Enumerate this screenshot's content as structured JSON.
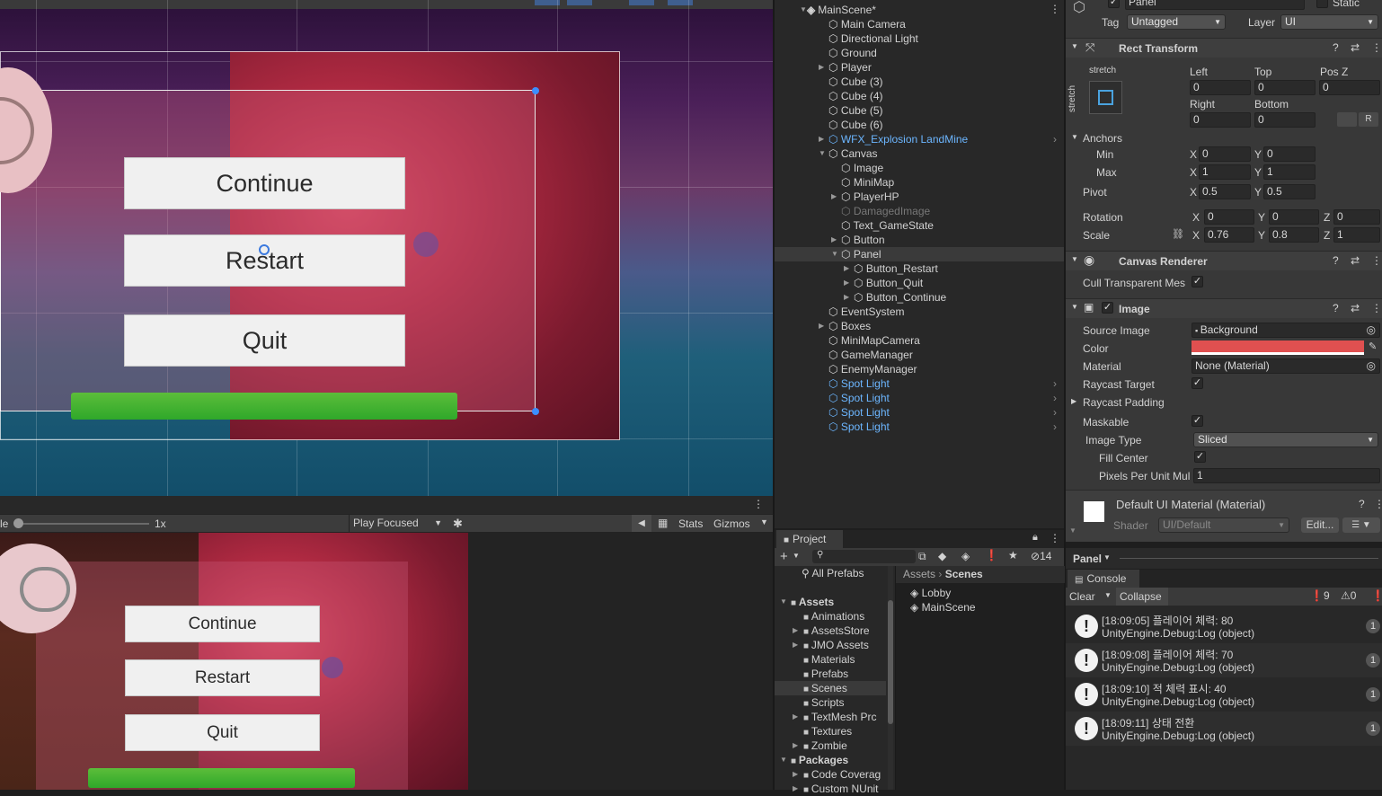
{
  "scene_ui": {
    "continue": "Continue",
    "restart": "Restart",
    "quit": "Quit"
  },
  "game_ui": {
    "continue": "Continue",
    "restart": "Restart",
    "quit": "Quit"
  },
  "game_toolbar": {
    "scale_left": "le",
    "scale_value": "1x",
    "play_mode": "Play Focused",
    "stats": "Stats",
    "gizmos": "Gizmos"
  },
  "hierarchy": {
    "scene": "MainScene*",
    "items": [
      {
        "label": "Main Camera"
      },
      {
        "label": "Directional Light"
      },
      {
        "label": "Ground"
      },
      {
        "label": "Player"
      },
      {
        "label": "Cube (3)"
      },
      {
        "label": "Cube (4)"
      },
      {
        "label": "Cube (5)"
      },
      {
        "label": "Cube (6)"
      },
      {
        "label": "WFX_Explosion LandMine"
      },
      {
        "label": "Canvas"
      },
      {
        "label": "Image"
      },
      {
        "label": "MiniMap"
      },
      {
        "label": "PlayerHP"
      },
      {
        "label": "DamagedImage"
      },
      {
        "label": "Text_GameState"
      },
      {
        "label": "Button"
      },
      {
        "label": "Panel"
      },
      {
        "label": "Button_Restart"
      },
      {
        "label": "Button_Quit"
      },
      {
        "label": "Button_Continue"
      },
      {
        "label": "EventSystem"
      },
      {
        "label": "Boxes"
      },
      {
        "label": "MiniMapCamera"
      },
      {
        "label": "GameManager"
      },
      {
        "label": "EnemyManager"
      },
      {
        "label": "Spot Light"
      },
      {
        "label": "Spot Light"
      },
      {
        "label": "Spot Light"
      },
      {
        "label": "Spot Light"
      }
    ]
  },
  "inspector": {
    "name": "Panel",
    "static": "Static",
    "tag_label": "Tag",
    "tag": "Untagged",
    "layer_label": "Layer",
    "layer": "UI",
    "rect_transform": "Rect Transform",
    "stretch_top": "stretch",
    "stretch_side": "stretch",
    "left": "Left",
    "top": "Top",
    "posz": "Pos Z",
    "left_v": "0",
    "top_v": "0",
    "posz_v": "0",
    "right": "Right",
    "bottom": "Bottom",
    "right_v": "0",
    "bottom_v": "0",
    "r_btn": "R",
    "anchors": "Anchors",
    "min": "Min",
    "max": "Max",
    "x": "X",
    "y": "Y",
    "z": "Z",
    "min_x": "0",
    "min_y": "0",
    "max_x": "1",
    "max_y": "1",
    "pivot": "Pivot",
    "pivot_x": "0.5",
    "pivot_y": "0.5",
    "rotation": "Rotation",
    "rot_x": "0",
    "rot_y": "0",
    "rot_z": "0",
    "scale": "Scale",
    "scale_x": "0.76",
    "scale_y": "0.8",
    "scale_z": "1",
    "canvas_renderer": "Canvas Renderer",
    "cull": "Cull Transparent Mes",
    "image": "Image",
    "source_image": "Source Image",
    "source_image_v": "Background",
    "color": "Color",
    "color_v": "#e05050",
    "material": "Material",
    "material_v": "None (Material)",
    "raycast_target": "Raycast Target",
    "raycast_padding": "Raycast Padding",
    "maskable": "Maskable",
    "image_type": "Image Type",
    "image_type_v": "Sliced",
    "fill_center": "Fill Center",
    "ppu": "Pixels Per Unit Mul",
    "ppu_v": "1",
    "default_mat": "Default UI Material (Material)",
    "shader": "Shader",
    "shader_v": "UI/Default",
    "edit": "Edit...",
    "panel_footer": "Panel"
  },
  "project": {
    "tab": "Project",
    "count": "14",
    "all_prefabs": "All Prefabs",
    "breadcrumb_root": "Assets",
    "breadcrumb_leaf": "Scenes",
    "tree": [
      {
        "label": "Assets",
        "bold": true
      },
      {
        "label": "Animations"
      },
      {
        "label": "AssetsStore"
      },
      {
        "label": "JMO Assets"
      },
      {
        "label": "Materials"
      },
      {
        "label": "Prefabs"
      },
      {
        "label": "Scenes"
      },
      {
        "label": "Scripts"
      },
      {
        "label": "TextMesh Prc"
      },
      {
        "label": "Textures"
      },
      {
        "label": "Zombie"
      },
      {
        "label": "Packages",
        "bold": true
      },
      {
        "label": "Code Coverag"
      },
      {
        "label": "Custom NUnit"
      }
    ],
    "files": [
      {
        "label": "Lobby"
      },
      {
        "label": "MainScene"
      }
    ]
  },
  "console": {
    "tab": "Console",
    "clear": "Clear",
    "collapse": "Collapse",
    "warn_count": "9",
    "err_count": "0",
    "entries": [
      {
        "line1": "[18:09:05] 플레이어 체력: 80",
        "line2": "UnityEngine.Debug:Log (object)",
        "count": "1"
      },
      {
        "line1": "[18:09:08] 플레이어 체력: 70",
        "line2": "UnityEngine.Debug:Log (object)",
        "count": "1"
      },
      {
        "line1": "[18:09:10] 적 체력 표시: 40",
        "line2": "UnityEngine.Debug:Log (object)",
        "count": "1"
      },
      {
        "line1": "[18:09:11] 상태 전환",
        "line2": "UnityEngine.Debug:Log (object)",
        "count": "1"
      }
    ]
  },
  "colors": {
    "accent": "#4a9eff",
    "selection": "#3a3a3a",
    "image_color": "#e05050"
  }
}
